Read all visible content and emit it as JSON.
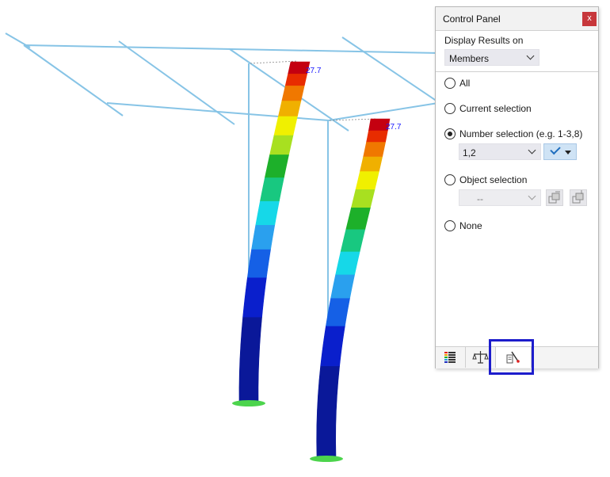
{
  "viewport": {
    "labels": [
      "27.7",
      "27.7"
    ],
    "colors": {
      "frame_line": "#87c4e6",
      "support": "#4cd44c",
      "label": "#1a1aff",
      "result_scale": [
        "#0a1899",
        "#0a1fcc",
        "#1560e6",
        "#2aa0ee",
        "#16d8e8",
        "#18c880",
        "#1db02a",
        "#a8e020",
        "#f0f000",
        "#f0b000",
        "#f07800",
        "#e82c00",
        "#c40010"
      ]
    }
  },
  "panel": {
    "title": "Control Panel",
    "close_label": "x",
    "display_results_label": "Display Results on",
    "display_results_value": "Members",
    "options": {
      "all": "All",
      "current": "Current selection",
      "number": "Number selection (e.g. 1-3,8)",
      "object": "Object selection",
      "none": "None"
    },
    "selected_option": "number",
    "number_value": "1,2",
    "object_value": "--",
    "tabs": [
      "color-scale",
      "balance",
      "selection-filter"
    ],
    "active_tab": "selection-filter"
  }
}
